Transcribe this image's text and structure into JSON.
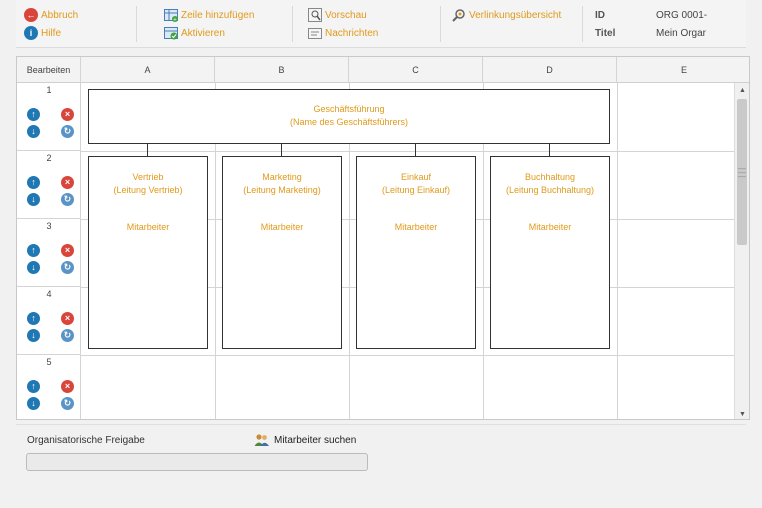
{
  "toolbar": {
    "abbruch": "Abbruch",
    "hilfe": "Hilfe",
    "zeile_hinzufuegen": "Zeile hinzufügen",
    "aktivieren": "Aktivieren",
    "vorschau": "Vorschau",
    "nachrichten": "Nachrichten",
    "verlinkungsuebersicht": "Verlinkungsübersicht",
    "id_label": "ID",
    "id_value": "ORG 0001-",
    "titel_label": "Titel",
    "titel_value": "Mein Orgar"
  },
  "grid": {
    "edit_header": "Bearbeiten",
    "columns": [
      "A",
      "B",
      "C",
      "D",
      "E"
    ],
    "rows": [
      "1",
      "2",
      "3",
      "4",
      "5"
    ]
  },
  "chart": {
    "top": {
      "title": "Geschäftsführung",
      "sub": "(Name des Geschäftsführers)"
    },
    "departments": [
      {
        "title": "Vertrieb",
        "sub": "(Leitung Vertrieb)",
        "staff": "Mitarbeiter"
      },
      {
        "title": "Marketing",
        "sub": "(Leitung Marketing)",
        "staff": "Mitarbeiter"
      },
      {
        "title": "Einkauf",
        "sub": "(Leitung Einkauf)",
        "staff": "Mitarbeiter"
      },
      {
        "title": "Buchhaltung",
        "sub": "(Leitung Buchhaltung)",
        "staff": "Mitarbeiter"
      }
    ]
  },
  "bottom": {
    "label": "Organisatorische Freigabe",
    "search": "Mitarbeiter suchen",
    "input_value": ""
  },
  "colors": {
    "accent": "#e09a1b",
    "blue": "#1f78b4",
    "red": "#d9453a"
  },
  "icons": {
    "abbruch": "cancel-icon",
    "hilfe": "info-icon",
    "zeile": "add-row-icon",
    "aktivieren": "activate-icon",
    "vorschau": "preview-icon",
    "nachrichten": "message-icon",
    "verlinkung": "link-overview-icon",
    "search": "users-search-icon"
  }
}
